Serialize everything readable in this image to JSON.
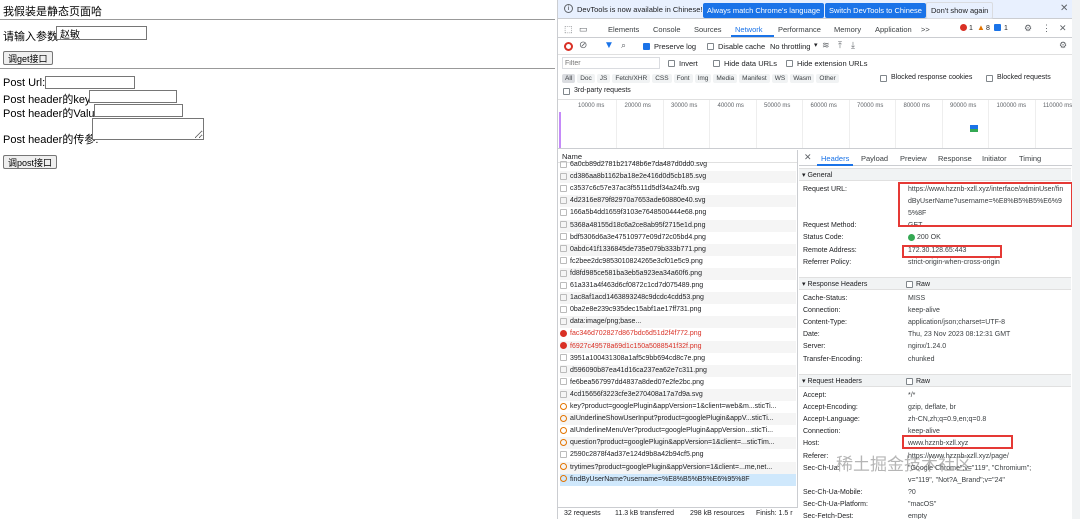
{
  "page": {
    "title": "我假装是静态页面哈",
    "param_label": "请输入参数:",
    "param_value": "赵敏",
    "get_button": "调get接口",
    "post_url_label": "Post Url:",
    "post_key_label": "Post header的key:",
    "post_value_label": "Post header的Value:",
    "post_param_label": "Post header的传参:",
    "post_button": "调post接口"
  },
  "devtools": {
    "banner": {
      "text": "DevTools is now available in Chinese!",
      "match_btn": "Always match Chrome's language",
      "switch_btn": "Switch DevTools to Chinese",
      "dismiss_btn": "Don't show again"
    },
    "tabs": [
      "Elements",
      "Console",
      "Sources",
      "Network",
      "Performance",
      "Memory",
      "Application",
      ">>"
    ],
    "active_tab": "Network",
    "counts": {
      "errors": "1",
      "warnings": "8",
      "info": "1"
    },
    "toolbar": {
      "preserve_log": "Preserve log",
      "disable_cache": "Disable cache",
      "throttling": "No throttling"
    },
    "filter": {
      "placeholder": "Filter",
      "invert": "Invert",
      "hide_data_urls": "Hide data URLs",
      "hide_ext_urls": "Hide extension URLs"
    },
    "types": [
      "All",
      "Doc",
      "JS",
      "Fetch/XHR",
      "CSS",
      "Font",
      "Img",
      "Media",
      "Manifest",
      "WS",
      "Wasm",
      "Other"
    ],
    "blocked_cookies": "Blocked response cookies",
    "blocked_requests": "Blocked requests",
    "third_party": "3rd-party requests",
    "timeline": [
      "10000 ms",
      "20000 ms",
      "30000 ms",
      "40000 ms",
      "50000 ms",
      "60000 ms",
      "70000 ms",
      "80000 ms",
      "90000 ms",
      "100000 ms",
      "110000 ms"
    ],
    "name_header": "Name",
    "requests": [
      {
        "name": "6a0cb89d2781b21748b6e7da487d0dd0.svg",
        "type": "img"
      },
      {
        "name": "cd386aa8b1162ba18e2e416d0d5cb185.svg",
        "type": "img"
      },
      {
        "name": "c3537c6c57e37ac3f5511d5df34a24fb.svg",
        "type": "img"
      },
      {
        "name": "4d2316e879f82970a7653ade60880e40.svg",
        "type": "img"
      },
      {
        "name": "166a5b4dd1659f3103e7648500444e68.png",
        "type": "img"
      },
      {
        "name": "5368a48155d18c6a2ce8ab95f2715e1d.png",
        "type": "img"
      },
      {
        "name": "bdf5306d6a3e47510977e09d72c05bd4.png",
        "type": "img"
      },
      {
        "name": "0abdc41f1336845de735e079b333b771.png",
        "type": "img"
      },
      {
        "name": "fc2bee2dc9853010824265e3cf01e5c9.png",
        "type": "img"
      },
      {
        "name": "fd8fd985ce581ba3eb5a923ea34a60f6.png",
        "type": "img"
      },
      {
        "name": "61a331a4f463d6cf0872c1cd7d075489.png",
        "type": "img"
      },
      {
        "name": "1ac8af1acd1463893248c9dcdc4cdd53.png",
        "type": "img"
      },
      {
        "name": "0ba2e8e239c935dec15abf1ae17ff731.png",
        "type": "img"
      },
      {
        "name": "data:image/png;base...",
        "type": "img"
      },
      {
        "name": "fac346d702827d867bdc6d51d2f4f772.png",
        "type": "err"
      },
      {
        "name": "f6927c49578a69d1c150a5088541f32f.png",
        "type": "err"
      },
      {
        "name": "3951a100431308a1af5c9bb694cd8c7e.png",
        "type": "img"
      },
      {
        "name": "d596090b87ea41d16ca237ea62e7c311.png",
        "type": "img"
      },
      {
        "name": "fe6bea567997dd4837a8ded07e2fe2bc.png",
        "type": "img"
      },
      {
        "name": "4cd15656f3223cfe3e270408a17a7d9a.svg",
        "type": "img"
      },
      {
        "name": "key?product=googlePlugin&appVersion=1&client=web&m...sticTi...",
        "type": "xhr"
      },
      {
        "name": "aIUnderlineShowUserInput?product=googlePlugin&appV...sticTi...",
        "type": "xhr"
      },
      {
        "name": "aIUnderlineMenuVer?product=googlePlugin&appVersion...sticTi...",
        "type": "xhr"
      },
      {
        "name": "question?product=googlePlugin&appVersion=1&client=...sticTim...",
        "type": "xhr"
      },
      {
        "name": "2590c2878f4ad37e124d9b8a42b94cf5.png",
        "type": "img"
      },
      {
        "name": "trytimes?product=googlePlugin&appVersion=1&client=...me,net...",
        "type": "xhr"
      },
      {
        "name": "findByUserName?username=%E8%B5%B5%E6%95%8F",
        "type": "xhr"
      }
    ],
    "status_bar": {
      "requests": "32 requests",
      "transferred": "11.3 kB transferred",
      "resources": "298 kB resources",
      "finish": "Finish: 1.5 r"
    },
    "detail_tabs": [
      "Headers",
      "Payload",
      "Preview",
      "Response",
      "Initiator",
      "Timing"
    ],
    "general_title": "▾ General",
    "general": [
      {
        "k": "Request URL:",
        "v": "https://www.hzznb-xzll.xyz/interface/adminUser/fin"
      },
      {
        "k": "",
        "v": "dByUserName?username=%E8%B5%B5%E6%9"
      },
      {
        "k": "",
        "v": "5%8F"
      },
      {
        "k": "Request Method:",
        "v": "GET"
      },
      {
        "k": "Status Code:",
        "v": "200 OK"
      },
      {
        "k": "Remote Address:",
        "v": "172.30.128.65:443"
      },
      {
        "k": "Referrer Policy:",
        "v": "strict-origin-when-cross-origin"
      }
    ],
    "resp_title": "▾ Response Headers",
    "raw": "Raw",
    "resp": [
      {
        "k": "Cache-Status:",
        "v": "MISS"
      },
      {
        "k": "Connection:",
        "v": "keep-alive"
      },
      {
        "k": "Content-Type:",
        "v": "application/json;charset=UTF-8"
      },
      {
        "k": "Date:",
        "v": "Thu, 23 Nov 2023 08:12:31 GMT"
      },
      {
        "k": "Server:",
        "v": "nginx/1.24.0"
      },
      {
        "k": "Transfer-Encoding:",
        "v": "chunked"
      }
    ],
    "req_title": "▾ Request Headers",
    "reqh": [
      {
        "k": "Accept:",
        "v": "*/*"
      },
      {
        "k": "Accept-Encoding:",
        "v": "gzip, deflate, br"
      },
      {
        "k": "Accept-Language:",
        "v": "zh-CN,zh;q=0.9,en;q=0.8"
      },
      {
        "k": "Connection:",
        "v": "keep-alive"
      },
      {
        "k": "Host:",
        "v": "www.hzznb-xzll.xyz"
      },
      {
        "k": "Referer:",
        "v": "https://www.hzznb-xzll.xyz/page/"
      },
      {
        "k": "Sec-Ch-Ua:",
        "v": "\"Google Chrome\";v=\"119\", \"Chromium\";"
      },
      {
        "k": "",
        "v": "v=\"119\", \"Not?A_Brand\";v=\"24\""
      },
      {
        "k": "Sec-Ch-Ua-Mobile:",
        "v": "?0"
      },
      {
        "k": "Sec-Ch-Ua-Platform:",
        "v": "\"macOS\""
      },
      {
        "k": "Sec-Fetch-Dest:",
        "v": "empty"
      }
    ],
    "watermark": "稀土掘金技术社区"
  }
}
